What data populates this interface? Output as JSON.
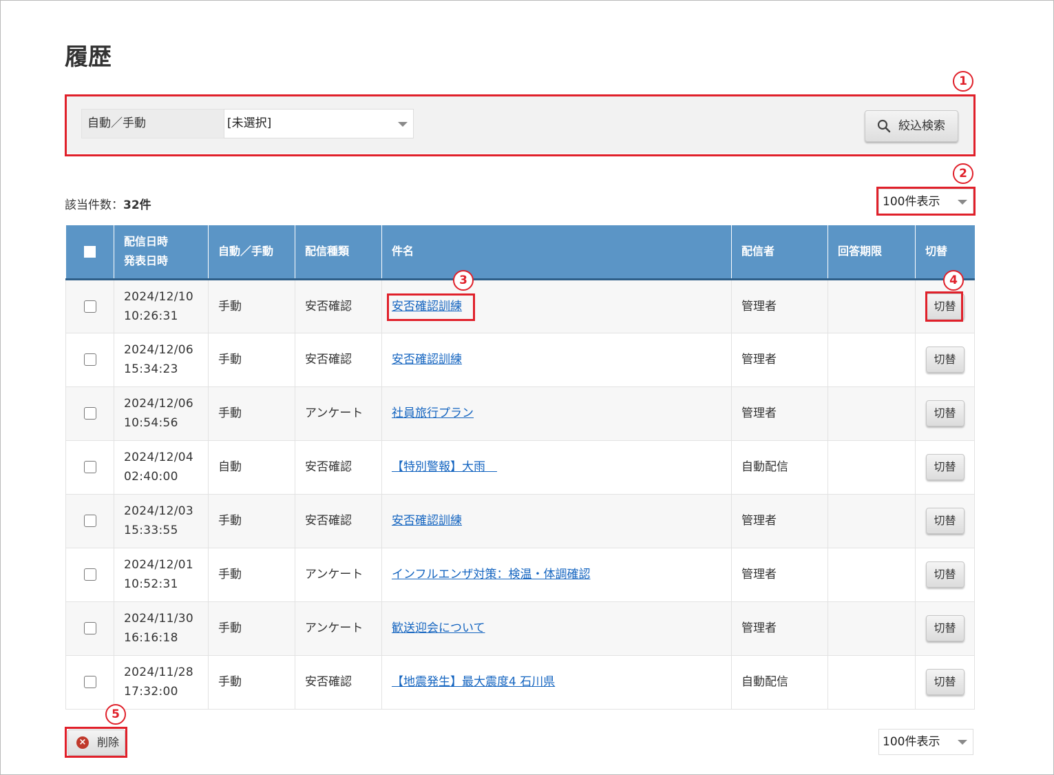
{
  "page": {
    "title": "履歴"
  },
  "filter": {
    "label": "自動／手動",
    "selected": "[未選択]",
    "search_button": "絞込検索"
  },
  "result": {
    "count_label": "該当件数：",
    "count_value": "32件"
  },
  "per_page": {
    "top": "100件表示",
    "bottom": "100件表示"
  },
  "annotations": [
    "1",
    "2",
    "3",
    "4",
    "5"
  ],
  "table": {
    "headers": {
      "datetime_line1": "配信日時",
      "datetime_line2": "発表日時",
      "mode": "自動／手動",
      "type": "配信種類",
      "subject": "件名",
      "sender": "配信者",
      "deadline": "回答期限",
      "switch": "切替"
    },
    "rows": [
      {
        "date": "2024/12/10",
        "time": "10:26:31",
        "mode": "手動",
        "type": "安否確認",
        "subject": "安否確認訓練",
        "sender": "管理者",
        "deadline": "",
        "switch": "切替"
      },
      {
        "date": "2024/12/06",
        "time": "15:34:23",
        "mode": "手動",
        "type": "安否確認",
        "subject": "安否確認訓練",
        "sender": "管理者",
        "deadline": "",
        "switch": "切替"
      },
      {
        "date": "2024/12/06",
        "time": "10:54:56",
        "mode": "手動",
        "type": "アンケート",
        "subject": "社員旅行プラン",
        "sender": "管理者",
        "deadline": "",
        "switch": "切替"
      },
      {
        "date": "2024/12/04",
        "time": "02:40:00",
        "mode": "自動",
        "type": "安否確認",
        "subject": "【特別警報】大雨　",
        "sender": "自動配信",
        "deadline": "",
        "switch": "切替"
      },
      {
        "date": "2024/12/03",
        "time": "15:33:55",
        "mode": "手動",
        "type": "安否確認",
        "subject": "安否確認訓練",
        "sender": "管理者",
        "deadline": "",
        "switch": "切替"
      },
      {
        "date": "2024/12/01",
        "time": "10:52:31",
        "mode": "手動",
        "type": "アンケート",
        "subject": "インフルエンザ対策：検温・体調確認",
        "sender": "管理者",
        "deadline": "",
        "switch": "切替"
      },
      {
        "date": "2024/11/30",
        "time": "16:16:18",
        "mode": "手動",
        "type": "アンケート",
        "subject": "歓送迎会について",
        "sender": "管理者",
        "deadline": "",
        "switch": "切替"
      },
      {
        "date": "2024/11/28",
        "time": "17:32:00",
        "mode": "手動",
        "type": "安否確認",
        "subject": "【地震発生】最大震度4 石川県",
        "sender": "自動配信",
        "deadline": "",
        "switch": "切替"
      }
    ]
  },
  "footer": {
    "delete_button": "削除"
  },
  "colors": {
    "header_bg": "#5b95c6",
    "annotation": "#e0202a",
    "link": "#1565c0"
  }
}
